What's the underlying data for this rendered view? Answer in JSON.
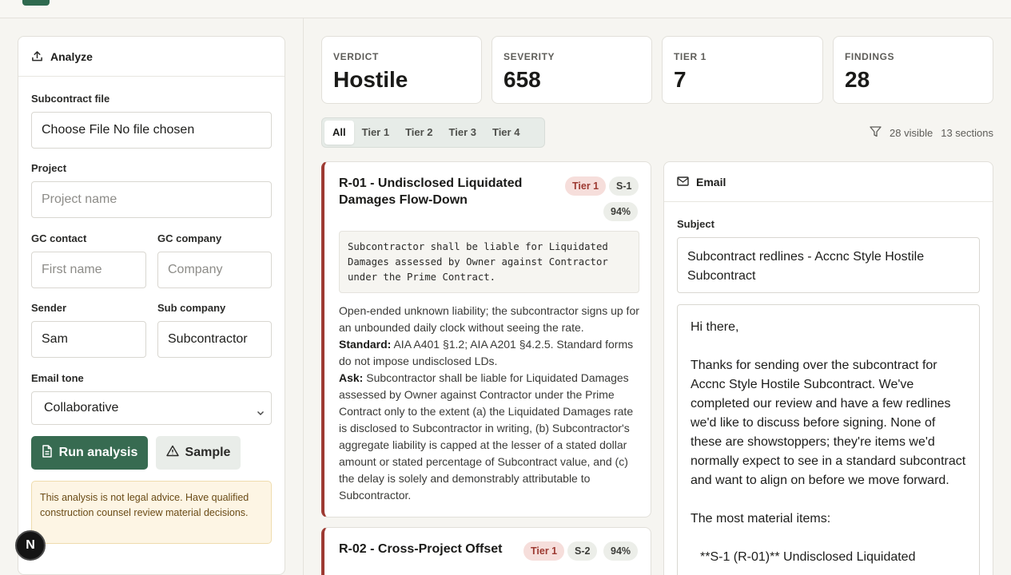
{
  "sidebar": {
    "title": "Analyze",
    "contract_file_label": "Subcontract file",
    "file_input_text": "Choose File No file chosen",
    "project_label": "Project",
    "project_placeholder": "Project name",
    "gc_contact_label": "GC contact",
    "gc_contact_placeholder": "First name",
    "gc_company_label": "GC company",
    "gc_company_placeholder": "Company",
    "sender_label": "Sender",
    "sender_value": "Sam",
    "sub_company_label": "Sub company",
    "sub_company_value": "Subcontractor",
    "tone_label": "Email tone",
    "tone_value": "Collaborative",
    "run_button": "Run analysis",
    "sample_button": "Sample",
    "disclaimer": "This analysis is not legal advice. Have qualified construction counsel review material decisions."
  },
  "badge": {
    "letter": "N"
  },
  "stats": [
    {
      "label": "VERDICT",
      "value": "Hostile"
    },
    {
      "label": "SEVERITY",
      "value": "658"
    },
    {
      "label": "TIER 1",
      "value": "7"
    },
    {
      "label": "FINDINGS",
      "value": "28"
    }
  ],
  "tabs": [
    "All",
    "Tier 1",
    "Tier 2",
    "Tier 3",
    "Tier 4"
  ],
  "filter": {
    "visible": "28 visible",
    "sections": "13 sections"
  },
  "findings": [
    {
      "title": "R-01 - Undisclosed Liquidated Damages Flow-Down",
      "tier": "Tier 1",
      "section": "S-1",
      "confidence": "94%",
      "clause": "Subcontractor shall be liable for Liquidated\nDamages assessed by Owner against Contractor\nunder the Prime Contract.",
      "rationale": "Open-ended unknown liability; the subcontractor signs up for an unbounded daily clock without seeing the rate.",
      "standard_label": "Standard:",
      "standard": "AIA A401 §1.2; AIA A201 §4.2.5. Standard forms do not impose undisclosed LDs.",
      "ask_label": "Ask:",
      "ask": "Subcontractor shall be liable for Liquidated Damages assessed by Owner against Contractor under the Prime Contract only to the extent (a) the Liquidated Damages rate is disclosed to Subcontractor in writing, (b) Subcontractor's aggregate liability is capped at the lesser of a stated dollar amount or stated percentage of Subcontract value, and (c) the delay is solely and demonstrably attributable to Subcontractor."
    },
    {
      "title": "R-02 - Cross-Project Offset",
      "tier": "Tier 1",
      "section": "S-2",
      "confidence": "94%"
    }
  ],
  "email": {
    "title": "Email",
    "subject_label": "Subject",
    "subject": "Subcontract redlines - Accnc Style Hostile Subcontract",
    "greeting": "Hi there,",
    "para1": "Thanks for sending over the subcontract for Accnc Style Hostile Subcontract. We've completed our review and have a few redlines we'd like to discuss before signing. None of these are showstoppers; they're items we'd normally expect to see in a standard subcontract and want to align on before we move forward.",
    "para2": "The most material items:",
    "para3": "**S-1 (R-01)** Undisclosed Liquidated"
  }
}
